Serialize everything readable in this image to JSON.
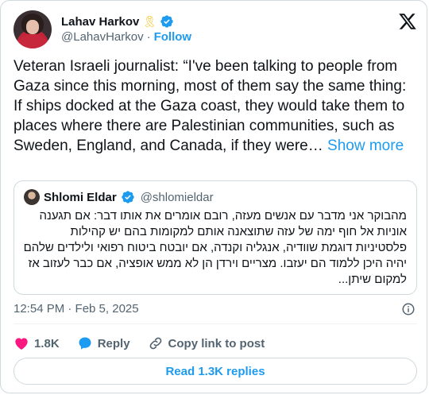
{
  "author": {
    "display_name": "Lahav Harkov",
    "handle": "@LahavHarkov",
    "separator": "·",
    "follow_label": "Follow",
    "badge_emoji": "🎗"
  },
  "tweet": {
    "text": "Veteran Israeli journalist: “I've been talking to people from Gaza since this morning, most of them say the same thing: If ships docked at the Gaza coast, they would take them to places where there are Palestinian communities, such as Sweden, England, and Canada, if they were…",
    "show_more_label": "Show more",
    "timestamp": "12:54 PM · Feb 5, 2025"
  },
  "quoted_tweet": {
    "display_name": "Shlomi Eldar",
    "handle": "@shlomieldar",
    "text": "מהבוקר אני מדבר עם אנשים מעזה, רובם אומרים את אותו דבר: אם תגענה אוניות אל חוף ימה של עזה שתוצאנה אותם למקומות בהם יש קהילות פלסטיניות דוגמת שוודיה, אנגליה וקנדה, אם יובטח ביטוח רפואי ולילדים שלהם יהיה היכן ללמוד הם יעזבו. מצריים וירדן הן לא ממש אופציה, אם כבר לעזוב אז למקום שיתן..."
  },
  "actions": {
    "like_count": "1.8K",
    "reply_label": "Reply",
    "copy_link_label": "Copy link to post"
  },
  "footer": {
    "read_replies_label": "Read 1.3K replies"
  },
  "icons": {
    "logo": "x-logo-icon",
    "verified": "verified-badge-icon",
    "info": "info-icon",
    "like": "heart-icon",
    "reply": "speech-bubble-icon",
    "copy": "link-icon"
  },
  "colors": {
    "accent": "#1d9bf0",
    "text": "#0f1419",
    "muted": "#536471",
    "like": "#f91880",
    "border": "#cfd9de"
  }
}
